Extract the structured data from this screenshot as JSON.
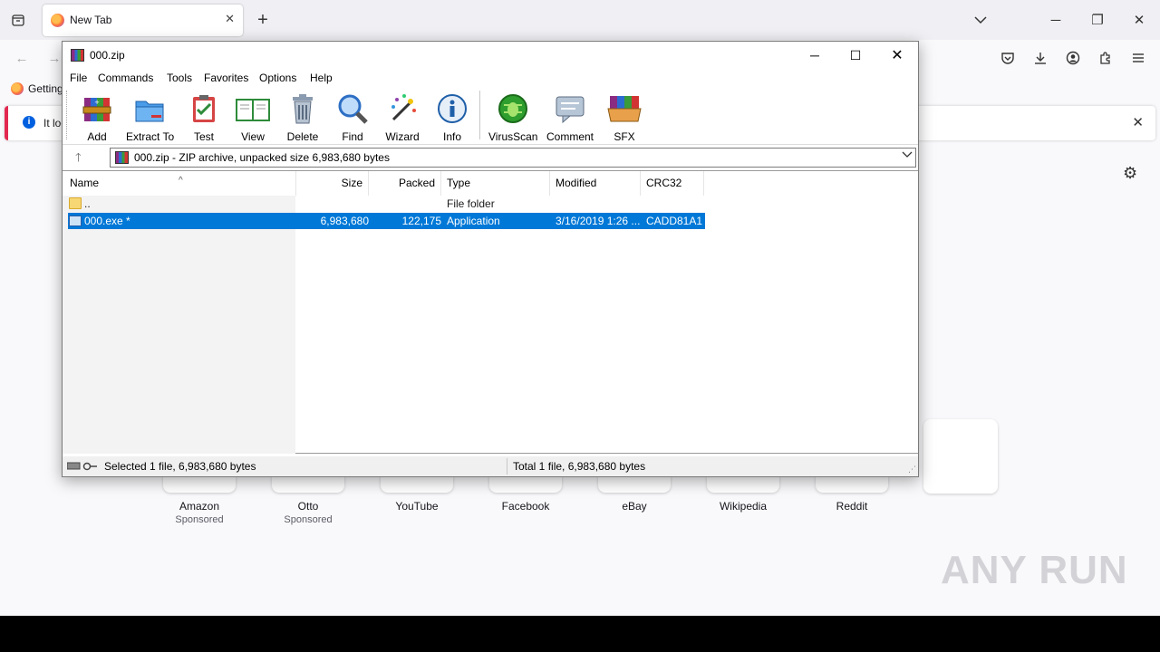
{
  "browser": {
    "tab_title": "New Tab",
    "bookmark_getting_started": "Getting",
    "notice_text": "It loo",
    "shortcuts": [
      {
        "label": "Amazon",
        "sponsor": "Sponsored"
      },
      {
        "label": "Otto",
        "sponsor": "Sponsored"
      },
      {
        "label": "YouTube",
        "sponsor": ""
      },
      {
        "label": "Facebook",
        "sponsor": ""
      },
      {
        "label": "eBay",
        "sponsor": ""
      },
      {
        "label": "Wikipedia",
        "sponsor": ""
      },
      {
        "label": "Reddit",
        "sponsor": ""
      }
    ],
    "watermark": "ANY RUN"
  },
  "winrar": {
    "title": "000.zip",
    "menu": [
      "File",
      "Commands",
      "Tools",
      "Favorites",
      "Options",
      "Help"
    ],
    "toolbar": [
      {
        "label": "Add",
        "icon": "add-archive-icon",
        "color": "#c0392b"
      },
      {
        "label": "Extract To",
        "icon": "extract-folder-icon",
        "color": "#2f80d1"
      },
      {
        "label": "Test",
        "icon": "test-clipboard-icon",
        "color": "#d64545"
      },
      {
        "label": "View",
        "icon": "view-book-icon",
        "color": "#2e8b3a"
      },
      {
        "label": "Delete",
        "icon": "delete-bin-icon",
        "color": "#8a9bb0"
      },
      {
        "label": "Find",
        "icon": "find-magnifier-icon",
        "color": "#2d6fc4"
      },
      {
        "label": "Wizard",
        "icon": "wizard-wand-icon",
        "color": "#8e44ad"
      },
      {
        "label": "Info",
        "icon": "info-icon",
        "color": "#1f5fa8"
      },
      {
        "label": "VirusScan",
        "icon": "virusscan-icon",
        "color": "#2e9e2e"
      },
      {
        "label": "Comment",
        "icon": "comment-icon",
        "color": "#7f93a8"
      },
      {
        "label": "SFX",
        "icon": "sfx-boxes-icon",
        "color": "#e08a2b"
      }
    ],
    "path_text": "000.zip - ZIP archive, unpacked size 6,983,680 bytes",
    "columns": {
      "name": "Name",
      "size": "Size",
      "packed": "Packed",
      "type": "Type",
      "modified": "Modified",
      "crc": "CRC32"
    },
    "rows": [
      {
        "name": "..",
        "size": "",
        "packed": "",
        "type": "File folder",
        "modified": "",
        "crc": "",
        "selected": false
      },
      {
        "name": "000.exe *",
        "size": "6,983,680",
        "packed": "122,175",
        "type": "Application",
        "modified": "3/16/2019 1:26 ...",
        "crc": "CADD81A1",
        "selected": true
      }
    ],
    "status_left": "Selected 1 file, 6,983,680 bytes",
    "status_right": "Total 1 file, 6,983,680 bytes"
  }
}
